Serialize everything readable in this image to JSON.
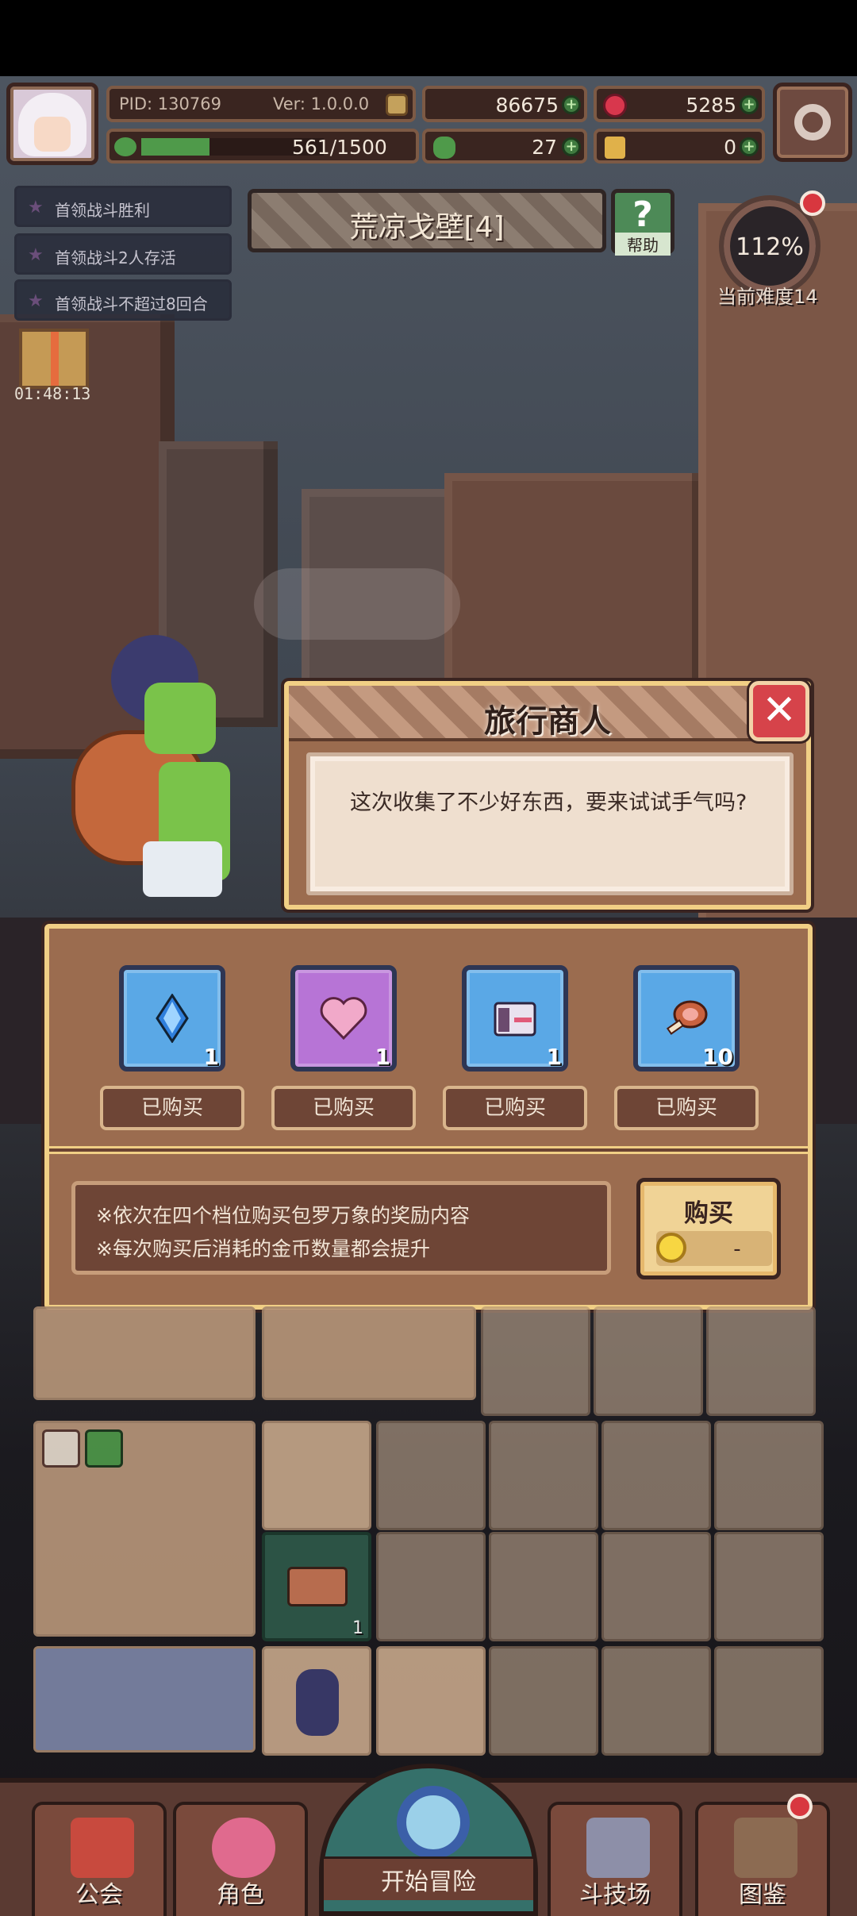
{
  "hud": {
    "pid": "PID: 130769",
    "version": "Ver: 1.0.0.0",
    "gold": "86675",
    "gems": "5285",
    "exp": "561/1500",
    "exp_fraction": 0.374,
    "clover": "27",
    "keys": "0"
  },
  "quests": [
    "首领战斗胜利",
    "首领战斗2人存活",
    "首领战斗不超过8回合"
  ],
  "gift_timer": "01:48:13",
  "location": {
    "title": "荒凉戈壁[4]",
    "help_label": "帮助",
    "help_glyph": "?"
  },
  "difficulty": {
    "percent": "112%",
    "label": "当前难度14"
  },
  "dialog": {
    "title": "旅行商人",
    "message": "这次收集了不少好东西，要来试试手气吗?",
    "close_glyph": "✕"
  },
  "shop": {
    "items": [
      {
        "name": "blue-crystal-icon",
        "qty": "1",
        "status": "已购买",
        "color": "#5aa8e6"
      },
      {
        "name": "pink-heart-icon",
        "qty": "1",
        "status": "已购买",
        "color": "#b774d6"
      },
      {
        "name": "chest-icon",
        "qty": "1",
        "status": "已购买",
        "color": "#5aa8e6"
      },
      {
        "name": "meat-icon",
        "qty": "10",
        "status": "已购买",
        "color": "#5aa8e6"
      }
    ],
    "info_line1": "※依次在四个档位购买包罗万象的奖励内容",
    "info_line2": "※每次购买后消耗的金币数量都会提升",
    "buy_label": "购买",
    "buy_price": "-"
  },
  "nav": {
    "guild": "公会",
    "character": "角色",
    "start": "开始冒险",
    "arena": "斗技场",
    "codex": "图鉴"
  },
  "colors": {
    "panel": "#9b6c4f",
    "panel_border": "#f1cf85",
    "close": "#d6434a",
    "buy": "#f0d396"
  }
}
